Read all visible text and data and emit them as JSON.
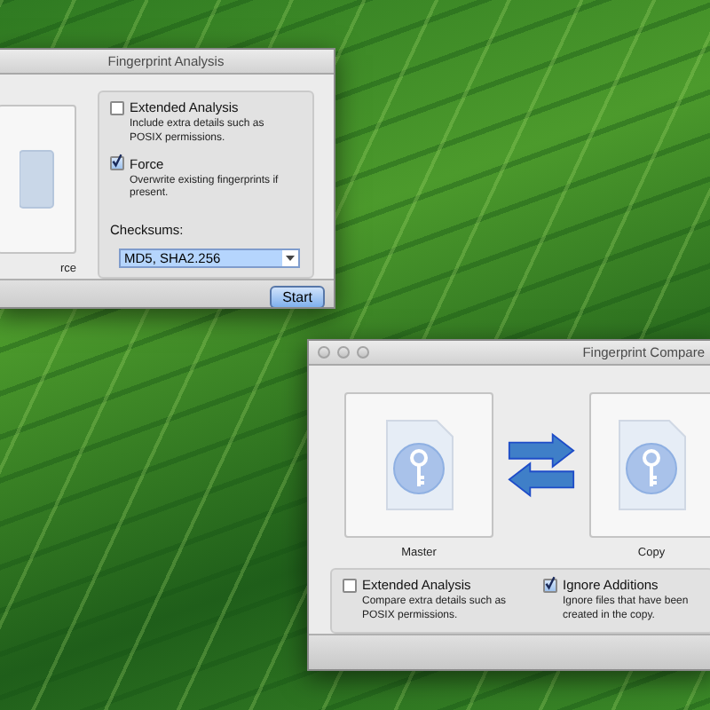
{
  "analysis_window": {
    "title": "Fingerprint Analysis",
    "drop_label": "rce",
    "options": [
      {
        "label": "Extended Analysis",
        "checked": false,
        "description": "Include extra details such as POSIX permissions."
      },
      {
        "label": "Force",
        "checked": true,
        "description": "Overwrite existing fingerprints if present."
      }
    ],
    "checksums_label": "Checksums:",
    "checksums_value": "MD5, SHA2.256",
    "start_button": "Start"
  },
  "compare_window": {
    "title": "Fingerprint Compare",
    "master_label": "Master",
    "copy_label": "Copy",
    "options": [
      {
        "label": "Extended Analysis",
        "checked": false,
        "description": "Compare extra details such as POSIX permissions."
      },
      {
        "label": "Ignore Additions",
        "checked": true,
        "description": "Ignore files that have been created in the copy."
      }
    ]
  }
}
